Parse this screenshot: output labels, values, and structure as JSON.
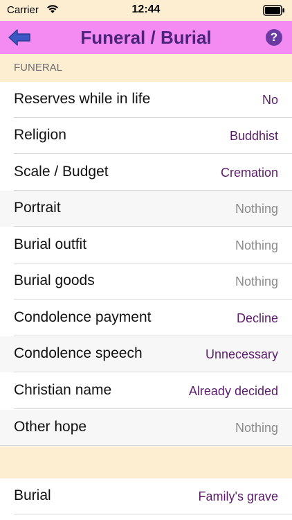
{
  "status_bar": {
    "carrier": "Carrier",
    "time": "12:44"
  },
  "nav": {
    "title": "Funeral / Burial",
    "back_icon": "back-arrow-icon",
    "help_icon": "help-icon",
    "help_glyph": "?"
  },
  "section_funeral": {
    "header": "FUNERAL",
    "rows": [
      {
        "label": "Reserves while in life",
        "value": "No"
      },
      {
        "label": "Religion",
        "value": "Buddhist"
      },
      {
        "label": "Scale / Budget",
        "value": "Cremation"
      },
      {
        "label": "Portrait",
        "value": "Nothing"
      },
      {
        "label": "Burial outfit",
        "value": "Nothing"
      },
      {
        "label": "Burial goods",
        "value": "Nothing"
      },
      {
        "label": "Condolence payment",
        "value": "Decline"
      },
      {
        "label": "Condolence speech",
        "value": "Unnecessary"
      },
      {
        "label": "Christian name",
        "value": "Already decided"
      },
      {
        "label": "Other hope",
        "value": "Nothing"
      }
    ]
  },
  "section_burial": {
    "header": "",
    "rows": [
      {
        "label": "Burial",
        "value": "Family's grave"
      }
    ]
  },
  "colors": {
    "nav_background": "#f48bf2",
    "title_color": "#4c237a",
    "section_background": "#fdeed2",
    "value_color": "#5b1d6a",
    "muted_value_color": "#8a8a8a"
  }
}
